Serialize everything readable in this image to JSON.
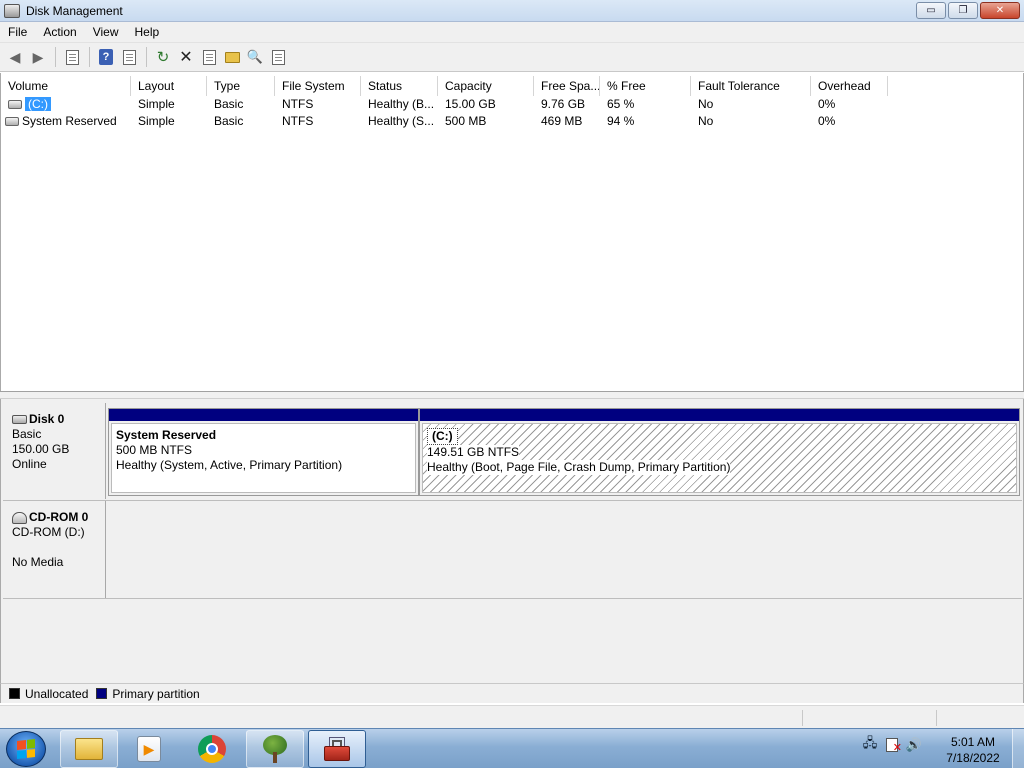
{
  "window": {
    "title": "Disk Management",
    "min_label": "▭",
    "max_label": "❐",
    "close_label": "✕"
  },
  "menu": [
    "File",
    "Action",
    "View",
    "Help"
  ],
  "toolbar": {
    "back_icon": "back-arrow-icon",
    "forward_icon": "forward-arrow-icon",
    "buttons": [
      "show-hide-console-tree",
      "help",
      "properties",
      "refresh",
      "delete",
      "properties-2",
      "open",
      "explore",
      "rescan"
    ]
  },
  "volume_list": {
    "columns": [
      "Volume",
      "Layout",
      "Type",
      "File System",
      "Status",
      "Capacity",
      "Free Spa...",
      "% Free",
      "Fault Tolerance",
      "Overhead"
    ],
    "rows": [
      {
        "volume": "(C:)",
        "layout": "Simple",
        "type": "Basic",
        "fs": "NTFS",
        "status": "Healthy (B...",
        "capacity": "15.00 GB",
        "free": "9.76 GB",
        "pct_free": "65 %",
        "fault": "No",
        "overhead": "0%",
        "selected": true
      },
      {
        "volume": "System Reserved",
        "layout": "Simple",
        "type": "Basic",
        "fs": "NTFS",
        "status": "Healthy (S...",
        "capacity": "500 MB",
        "free": "469 MB",
        "pct_free": "94 %",
        "fault": "No",
        "overhead": "0%",
        "selected": false
      }
    ]
  },
  "disks": [
    {
      "name": "Disk 0",
      "type": "Basic",
      "size": "150.00 GB",
      "state": "Online",
      "partitions": [
        {
          "name": "System Reserved",
          "size": "500 MB NTFS",
          "status": "Healthy (System, Active, Primary Partition)"
        },
        {
          "name": "(C:)",
          "size": "149.51 GB NTFS",
          "status": "Healthy (Boot, Page File, Crash Dump, Primary Partition)"
        }
      ]
    },
    {
      "name": "CD-ROM 0",
      "type": "CD-ROM (D:)",
      "size": "",
      "state": "No Media"
    }
  ],
  "legend": [
    {
      "label": "Unallocated",
      "color": "#000000"
    },
    {
      "label": "Primary partition",
      "color": "#000080"
    }
  ],
  "taskbar": {
    "pinned": [
      "windows-explorer",
      "media-player",
      "chrome",
      "tree-app",
      "computer-management"
    ],
    "clock_time": "5:01 AM",
    "clock_date": "7/18/2022"
  },
  "colors": {
    "primary_partition": "#000080",
    "selection": "#3399ff"
  }
}
